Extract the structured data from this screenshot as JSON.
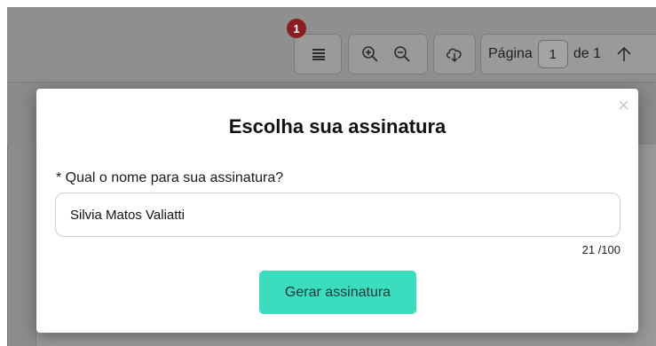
{
  "toolbar": {
    "notification_count": "1",
    "page_label": "Página",
    "page_value": "1",
    "page_of": "de 1",
    "icons": [
      "list-icon",
      "zoom-in-icon",
      "zoom-out-icon",
      "download-icon",
      "arrow-up-icon"
    ]
  },
  "modal": {
    "close_glyph": "×",
    "title": "Escolha sua assinatura",
    "field_label": "* Qual o nome para sua assinatura?",
    "field_value": "Silvia Matos Valiatti",
    "counter": "21 /100",
    "submit_label": "Gerar assinatura"
  },
  "colors": {
    "accent": "#3cdcbf",
    "badge": "#8a1d1d",
    "overlay": "#8f8f8f"
  }
}
